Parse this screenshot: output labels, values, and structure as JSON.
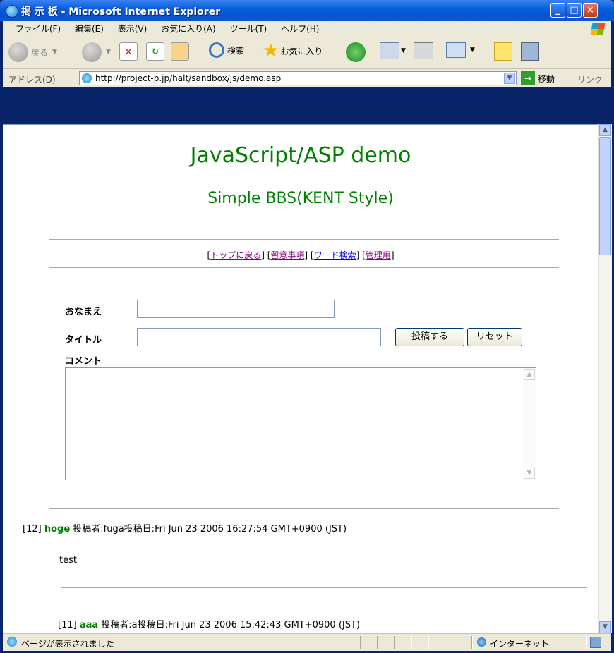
{
  "window": {
    "title": "掲 示 板 - Microsoft Internet Explorer"
  },
  "menu": [
    "ファイル(F)",
    "編集(E)",
    "表示(V)",
    "お気に入り(A)",
    "ツール(T)",
    "ヘルプ(H)"
  ],
  "toolbar": {
    "back": "戻る",
    "search": "検索",
    "favorites": "お気に入り"
  },
  "address": {
    "label": "アドレス(D)",
    "url": "http://project-p.jp/halt/sandbox/js/demo.asp",
    "go": "移動",
    "links": "リンク"
  },
  "page": {
    "title": "JavaScript/ASP demo",
    "subtitle": "Simple BBS(KENT Style)",
    "nav": {
      "top": "トップに戻る",
      "notes": "留意事項",
      "search": "ワード検索",
      "admin": "管理用"
    },
    "form": {
      "name_label": "おなまえ",
      "title_label": "タイトル",
      "comment_label": "コメント",
      "submit": "投稿する",
      "reset": "リセット",
      "name_value": "",
      "title_value": ""
    },
    "posts": [
      {
        "no": "[12]",
        "title": "hoge",
        "meta": " 投稿者:fuga投稿日:Fri Jun 23 2006 16:27:54 GMT+0900 (JST)",
        "body": "test"
      },
      {
        "no": "[11]",
        "title": "aaa",
        "meta": " 投稿者:a投稿日:Fri Jun 23 2006 15:42:43 GMT+0900 (JST)",
        "body": ""
      }
    ]
  },
  "status": {
    "text": "ページが表示されました",
    "zone": "インターネット"
  }
}
